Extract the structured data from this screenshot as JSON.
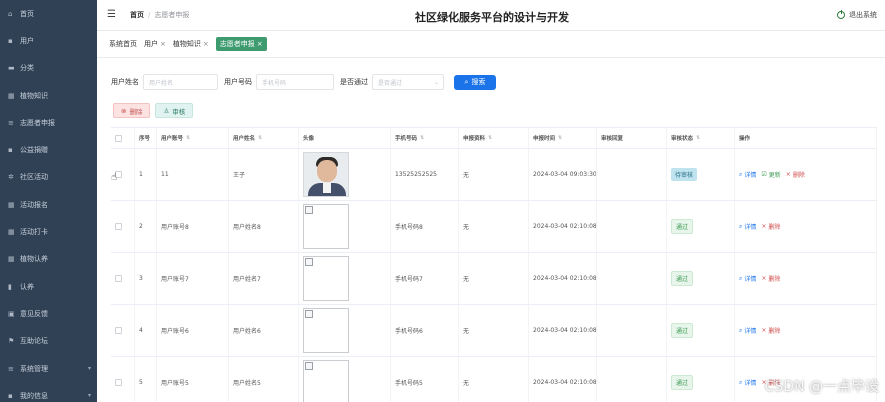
{
  "sidebar": {
    "items": [
      {
        "label": "首页",
        "icon": "home-icon",
        "glyph": "⌂"
      },
      {
        "label": "用户",
        "icon": "user-icon",
        "glyph": "▪"
      },
      {
        "label": "分类",
        "icon": "category-icon",
        "glyph": "▬"
      },
      {
        "label": "植物知识",
        "icon": "grid-icon",
        "glyph": "▦"
      },
      {
        "label": "志愿者申报",
        "icon": "list-icon",
        "glyph": "≡"
      },
      {
        "label": "公益捐赠",
        "icon": "donate-icon",
        "glyph": "▪"
      },
      {
        "label": "社区活动",
        "icon": "activity-icon",
        "glyph": "✲"
      },
      {
        "label": "活动报名",
        "icon": "signup-icon",
        "glyph": "▦"
      },
      {
        "label": "活动打卡",
        "icon": "checkin-icon",
        "glyph": "▦"
      },
      {
        "label": "植物认养",
        "icon": "adopt-icon",
        "glyph": "▦"
      },
      {
        "label": "认养",
        "icon": "adoption-icon",
        "glyph": "▮"
      },
      {
        "label": "意见反馈",
        "icon": "feedback-icon",
        "glyph": "▣"
      },
      {
        "label": "互助论坛",
        "icon": "forum-icon",
        "glyph": "⚑"
      },
      {
        "label": "系统管理",
        "icon": "settings-icon",
        "glyph": "≡",
        "arrow": "▾"
      },
      {
        "label": "我的信息",
        "icon": "profile-icon",
        "glyph": "▪",
        "arrow": "▾"
      }
    ]
  },
  "header": {
    "breadcrumb_home": "首页",
    "breadcrumb_sep": "/",
    "breadcrumb_current": "志愿者申报",
    "title": "社区绿化服务平台的设计与开发",
    "logout_label": "退出系统"
  },
  "tags": [
    {
      "label": "系统首页",
      "closable": false
    },
    {
      "label": "用户",
      "closable": true
    },
    {
      "label": "植物知识",
      "closable": true
    },
    {
      "label": "志愿者申报",
      "closable": true,
      "active": true
    }
  ],
  "search": {
    "username_label": "用户姓名",
    "username_placeholder": "用户姓名",
    "phone_label": "用户号码",
    "phone_placeholder": "手机号码",
    "passed_label": "是否通过",
    "passed_placeholder": "是否通过",
    "search_button": "搜索"
  },
  "actions": {
    "delete_label": "删除",
    "audit_label": "审核"
  },
  "table": {
    "columns": [
      "序号",
      "用户账号",
      "用户姓名",
      "头像",
      "手机号码",
      "申报资料",
      "申报时间",
      "审核回复",
      "审核状态",
      "操作"
    ],
    "rows": [
      {
        "index": "1",
        "account": "11",
        "name": "王子",
        "avatar": "photo",
        "phone": "13525252525",
        "material": "无",
        "time": "2024-03-04 09:03:30",
        "reply": "",
        "status": "待审核",
        "status_kind": "pending",
        "ops": [
          "详情",
          "更新",
          "删除"
        ]
      },
      {
        "index": "2",
        "account": "用户账号8",
        "name": "用户姓名8",
        "avatar": "broken",
        "phone": "手机号码8",
        "material": "无",
        "time": "2024-03-04 02:10:08",
        "reply": "",
        "status": "通过",
        "status_kind": "ok",
        "ops": [
          "详情",
          "删除"
        ]
      },
      {
        "index": "3",
        "account": "用户账号7",
        "name": "用户姓名7",
        "avatar": "broken",
        "phone": "手机号码7",
        "material": "无",
        "time": "2024-03-04 02:10:08",
        "reply": "",
        "status": "通过",
        "status_kind": "ok",
        "ops": [
          "详情",
          "删除"
        ]
      },
      {
        "index": "4",
        "account": "用户账号6",
        "name": "用户姓名6",
        "avatar": "broken",
        "phone": "手机号码6",
        "material": "无",
        "time": "2024-03-04 02:10:08",
        "reply": "",
        "status": "通过",
        "status_kind": "ok",
        "ops": [
          "详情",
          "删除"
        ]
      },
      {
        "index": "5",
        "account": "用户账号5",
        "name": "用户姓名5",
        "avatar": "broken",
        "phone": "手机号码5",
        "material": "无",
        "time": "2024-03-04 02:10:08",
        "reply": "",
        "status": "通过",
        "status_kind": "ok",
        "ops": [
          "详情",
          "删除"
        ]
      }
    ]
  },
  "watermark": "CSDN @一点毕设",
  "colors": {
    "sidebar": "#304156",
    "accent": "#1a73e8",
    "active_tag": "#3d9b6f"
  }
}
